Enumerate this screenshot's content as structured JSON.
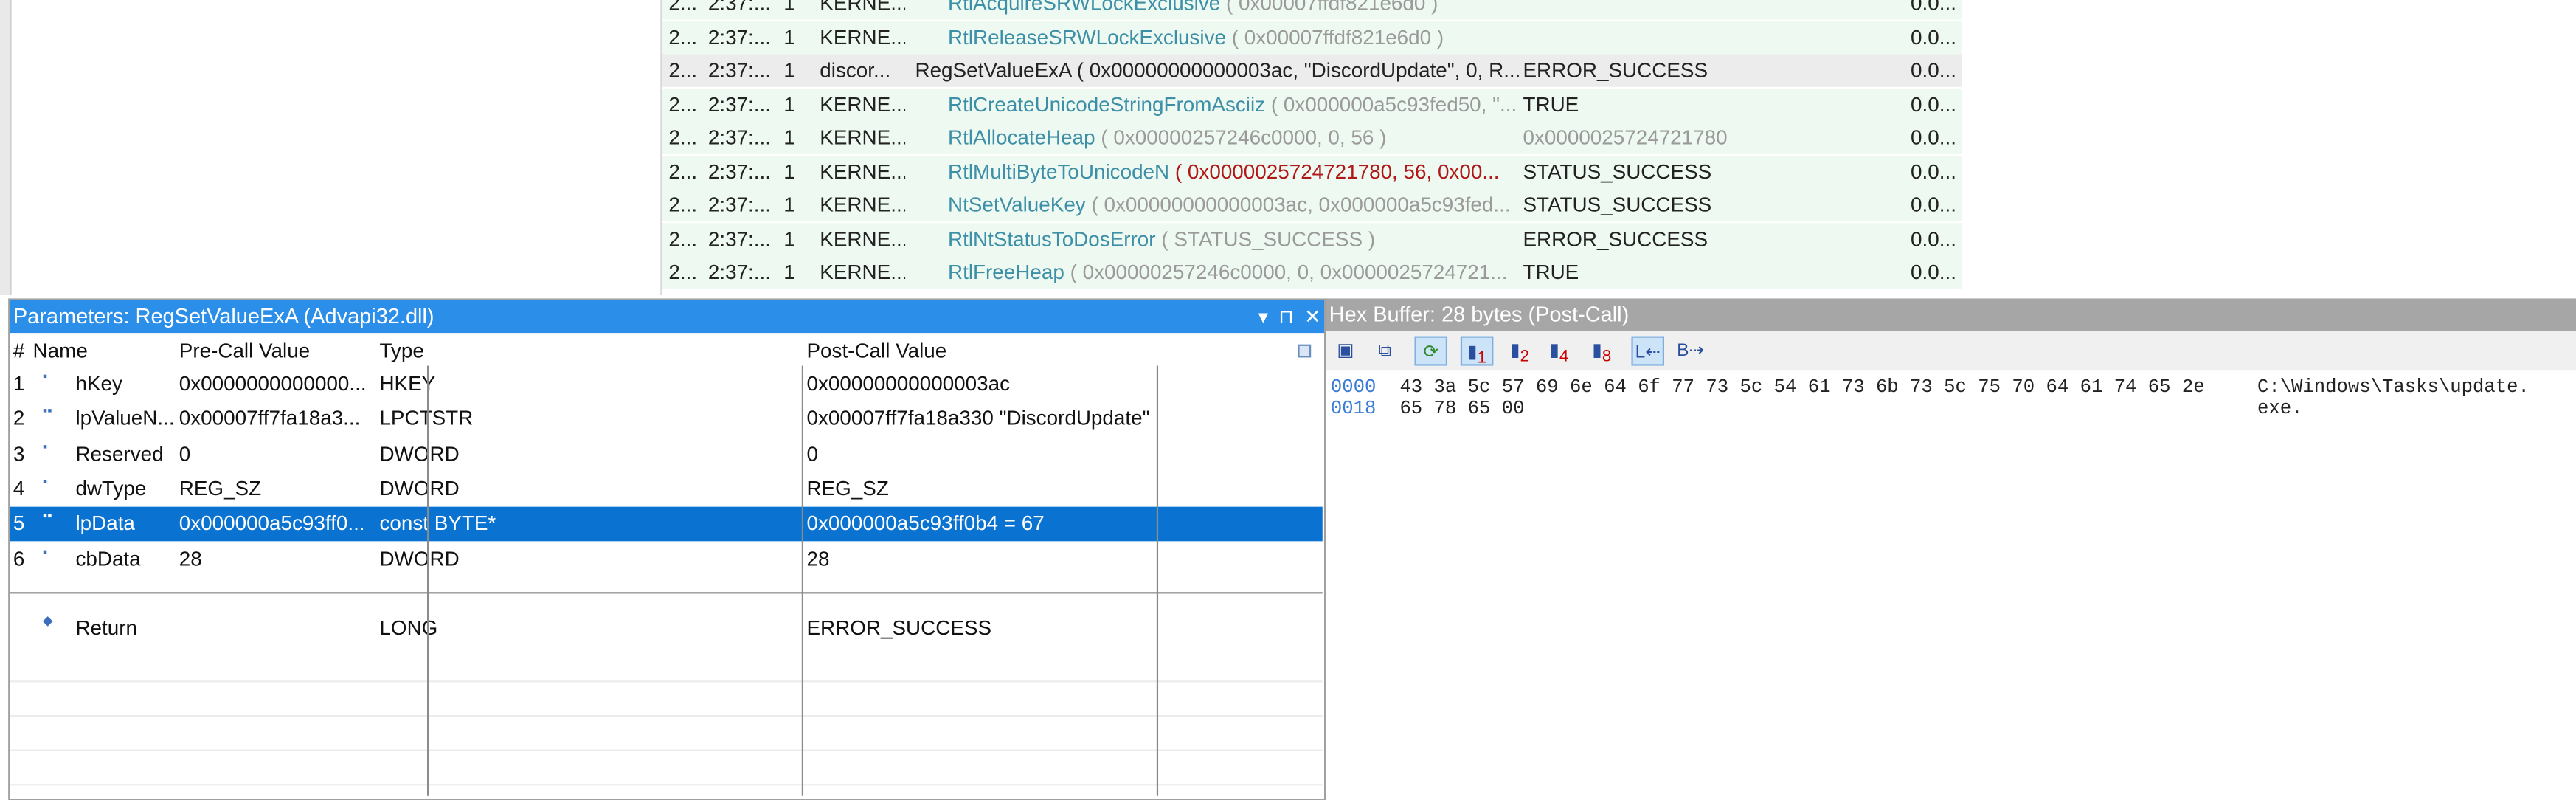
{
  "call_list": {
    "rows": [
      {
        "idx": "2...",
        "time": "2:37:...",
        "tid": "1",
        "module": "KERNE...",
        "fn": "RtlAcquireSRWLockExclusive",
        "args": "( 0x00007ffdf821e6d0 )",
        "ret": "",
        "dur": "0.0...",
        "style": "child"
      },
      {
        "idx": "2...",
        "time": "2:37:...",
        "tid": "1",
        "module": "KERNE...",
        "fn": "RtlReleaseSRWLockExclusive",
        "args": "( 0x00007ffdf821e6d0 )",
        "ret": "",
        "dur": "0.0...",
        "style": "child"
      },
      {
        "idx": "2...",
        "time": "2:37:...",
        "tid": "1",
        "module": "discor...",
        "fn": "RegSetValueExA",
        "args": "( 0x00000000000003ac, \"DiscordUpdate\", 0, R...",
        "ret": "ERROR_SUCCESS",
        "dur": "0.0...",
        "style": "selected"
      },
      {
        "idx": "2...",
        "time": "2:37:...",
        "tid": "1",
        "module": "KERNE...",
        "fn": "RtlCreateUnicodeStringFromAsciiz",
        "args": "( 0x000000a5c93fed50, \"...",
        "ret": "TRUE",
        "dur": "0.0...",
        "style": "child"
      },
      {
        "idx": "2...",
        "time": "2:37:...",
        "tid": "1",
        "module": "KERNE...",
        "fn": "RtlAllocateHeap",
        "args": "( 0x00000257246c0000, 0, 56 )",
        "ret": "0x0000025724721780",
        "dur": "0.0...",
        "style": "child-gray-ret"
      },
      {
        "idx": "2...",
        "time": "2:37:...",
        "tid": "1",
        "module": "KERNE...",
        "fn": "RtlMultiByteToUnicodeN",
        "args": "( 0x0000025724721780, 56, 0x00...",
        "ret": "STATUS_SUCCESS",
        "dur": "0.0...",
        "style": "child-red"
      },
      {
        "idx": "2...",
        "time": "2:37:...",
        "tid": "1",
        "module": "KERNE...",
        "fn": "NtSetValueKey",
        "args": "( 0x00000000000003ac, 0x000000a5c93fed...",
        "ret": "STATUS_SUCCESS",
        "dur": "0.0...",
        "style": "child"
      },
      {
        "idx": "2...",
        "time": "2:37:...",
        "tid": "1",
        "module": "KERNE...",
        "fn": "RtlNtStatusToDosError",
        "args": "( STATUS_SUCCESS )",
        "ret": "ERROR_SUCCESS",
        "dur": "0.0...",
        "style": "child"
      },
      {
        "idx": "2...",
        "time": "2:37:...",
        "tid": "1",
        "module": "KERNE...",
        "fn": "RtlFreeHeap",
        "args": "( 0x00000257246c0000, 0, 0x0000025724721...",
        "ret": "TRUE",
        "dur": "0.0...",
        "style": "child"
      }
    ]
  },
  "params": {
    "title": "Parameters: RegSetValueExA (Advapi32.dll)",
    "controls": {
      "dropdown": "▾",
      "pin": "⊓",
      "close": "✕"
    },
    "headers": {
      "num": "#",
      "name": "Name",
      "pre": "Pre-Call Value",
      "type": "Type",
      "post": "Post-Call Value"
    },
    "rows": [
      {
        "num": "1",
        "name": "hKey",
        "pre": "0x0000000000000...",
        "type": "HKEY",
        "post": "0x00000000000003ac"
      },
      {
        "num": "2",
        "name": "lpValueN...",
        "pre": "0x00007ff7fa18a3...",
        "type": "LPCTSTR",
        "post": "0x00007ff7fa18a330 \"DiscordUpdate\""
      },
      {
        "num": "3",
        "name": "Reserved",
        "pre": "0",
        "type": "DWORD",
        "post": "0"
      },
      {
        "num": "4",
        "name": "dwType",
        "pre": "REG_SZ",
        "type": "DWORD",
        "post": "REG_SZ"
      },
      {
        "num": "5",
        "name": "lpData",
        "pre": "0x000000a5c93ff0...",
        "type": "const BYTE*",
        "post": "0x000000a5c93ff0b4 = 67"
      },
      {
        "num": "6",
        "name": "cbData",
        "pre": "28",
        "type": "DWORD",
        "post": "28"
      }
    ],
    "return_row": {
      "name": "Return",
      "pre": "",
      "type": "LONG",
      "post": "ERROR_SUCCESS"
    }
  },
  "hex": {
    "title": "Hex Buffer: 28 bytes (Post-Call)",
    "toolbar": {
      "b1": "1",
      "b2": "2",
      "b4": "4",
      "b8": "8",
      "b_left": "L",
      "b_right": "B"
    },
    "lines": [
      {
        "offset": "0000",
        "bytes": "43 3a 5c 57 69 6e 64 6f 77 73 5c 54 61 73 6b 73 5c 75 70 64 61 74 65 2e",
        "ascii": "C:\\Windows\\Tasks\\update."
      },
      {
        "offset": "0018",
        "bytes": "65 78 65 00",
        "ascii": "exe."
      }
    ]
  },
  "colors": {
    "accent": "#2b8ee8",
    "selection": "#0a73d2",
    "child_row": "#eefaf1",
    "hex_offset": "#3a7bd5"
  }
}
